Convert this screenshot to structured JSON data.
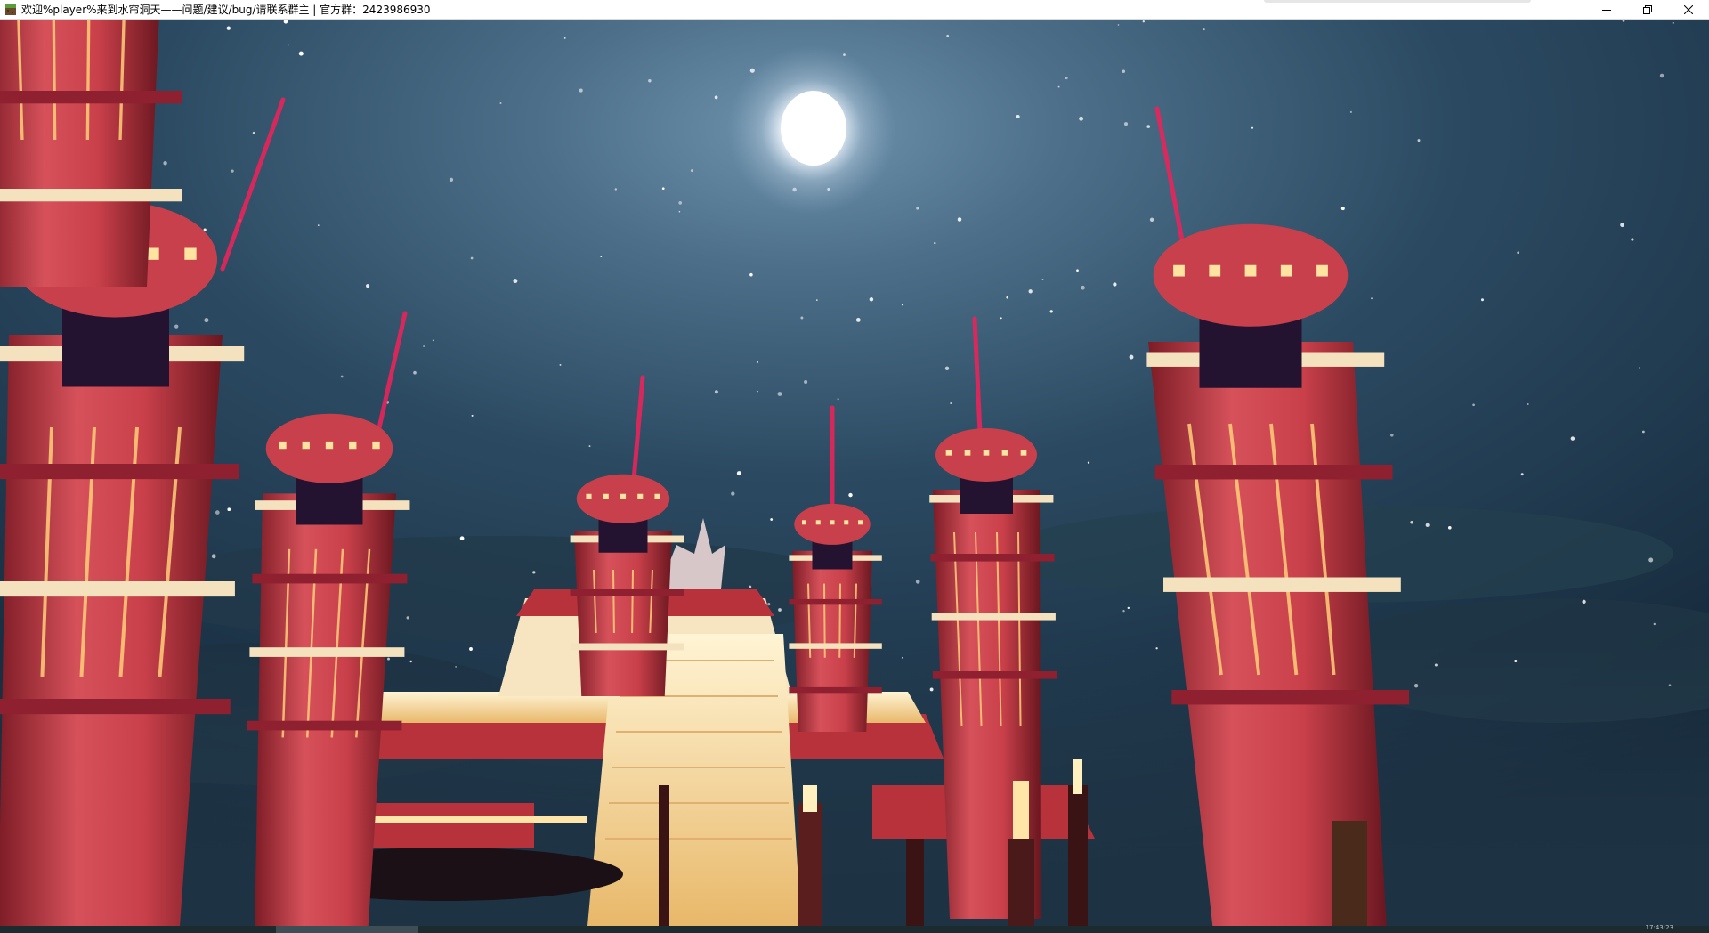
{
  "window": {
    "title": "欢迎%player%来到水帘洞天——问题/建议/bug/请联系群主 | 官方群：2423986930",
    "app_icon": "minecraft-block-icon",
    "buttons": {
      "minimize": "minimize-icon",
      "maximize": "restore-icon",
      "close": "close-icon"
    }
  },
  "scene": {
    "description_tag": "night-sky-red-towers",
    "sky_color_top": "#1d3548",
    "sky_color_center": "#4f7089",
    "tower_color": "#b8323c",
    "lantern_color": "#ffd98a",
    "beam_color": "#e8245a"
  },
  "taskbar": {
    "clock": "17:43:23"
  }
}
